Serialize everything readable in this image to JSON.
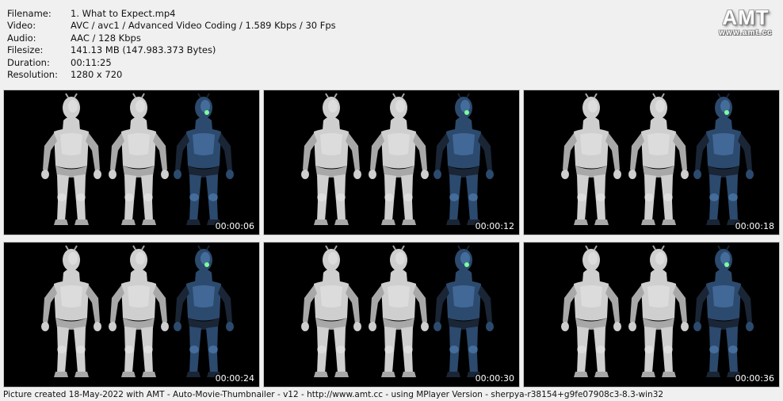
{
  "info": [
    {
      "key": "Filename:",
      "value": "1. What to Expect.mp4"
    },
    {
      "key": "Video:",
      "value": "AVC / avc1 / Advanced Video Coding / 1.589 Kbps / 30 Fps"
    },
    {
      "key": "Audio:",
      "value": "AAC / 128 Kbps"
    },
    {
      "key": "Filesize:",
      "value": "141.13 MB (147.983.373 Bytes)"
    },
    {
      "key": "Duration:",
      "value": "00:11:25"
    },
    {
      "key": "Resolution:",
      "value": "1280 x 720"
    }
  ],
  "logo": {
    "big": "AMT",
    "small": "www.amt.cc"
  },
  "thumbs": [
    {
      "time": "00:00:06"
    },
    {
      "time": "00:00:12"
    },
    {
      "time": "00:00:18"
    },
    {
      "time": "00:00:24"
    },
    {
      "time": "00:00:30"
    },
    {
      "time": "00:00:36"
    }
  ],
  "footer": "Picture created 18-May-2022 with AMT - Auto-Movie-Thumbnailer - v12 - http://www.amt.cc - using MPlayer Version - sherpya-r38154+g9fe07908c3-8.3-win32"
}
